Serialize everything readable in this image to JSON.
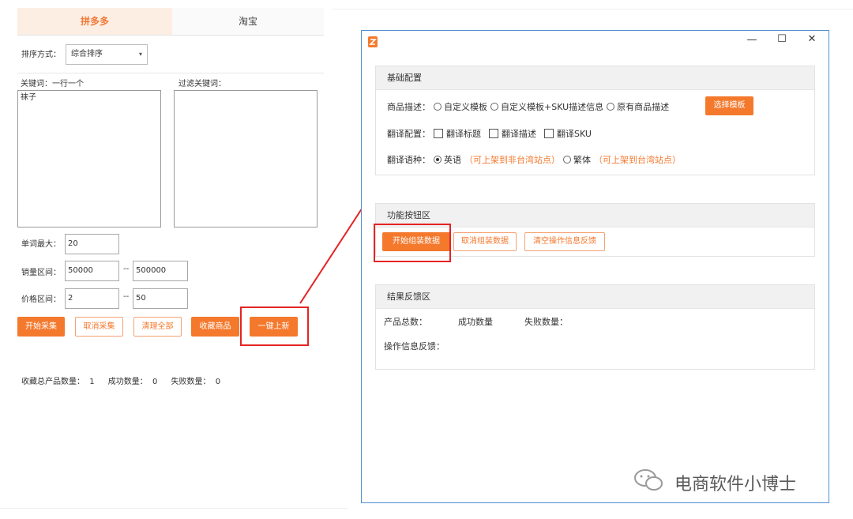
{
  "left": {
    "tabs": [
      {
        "label": "拼多多",
        "active": true
      },
      {
        "label": "淘宝",
        "active": false
      }
    ],
    "sort": {
      "label": "排序方式：",
      "value": "综合排序"
    },
    "keywords": {
      "label": "关键词：一行一个",
      "value": "袜子"
    },
    "filter": {
      "label": "过滤关键词：",
      "value": ""
    },
    "max_words": {
      "label": "单词最大：",
      "value": "20"
    },
    "sales_range": {
      "label": "销量区间：",
      "min": "50000",
      "sep": "--",
      "max": "500000"
    },
    "price_range": {
      "label": "价格区间：",
      "min": "2",
      "sep": "--",
      "max": "50"
    },
    "buttons": {
      "start": "开始采集",
      "cancel": "取消采集",
      "clear": "清理全部",
      "favorite": "收藏商品",
      "one_click": "一键上新"
    },
    "stats": {
      "total_label": "收藏总产品数量：",
      "total": "1",
      "success_label": "成功数量：",
      "success": "0",
      "fail_label": "失败数量：",
      "fail": "0"
    }
  },
  "window": {
    "controls": {
      "minimize": "—",
      "maximize": "☐",
      "close": "✕"
    },
    "basic": {
      "title": "基础配置",
      "desc_label": "商品描述：",
      "desc_options": [
        "自定义模板",
        "自定义模板+SKU描述信息",
        "原有商品描述"
      ],
      "template_button": "选择模板",
      "translate_label": "翻译配置：",
      "translate_options": [
        "翻译标题",
        "翻译描述",
        "翻译SKU"
      ],
      "lang_label": "翻译语种：",
      "lang_english": "英语",
      "lang_english_note": "（可上架到非台湾站点）",
      "lang_trad": "繁体",
      "lang_trad_note": "（可上架到台湾站点）"
    },
    "functions": {
      "title": "功能按钮区",
      "start": "开始组装数据",
      "cancel": "取消组装数据",
      "clear": "清空操作信息反馈"
    },
    "results": {
      "title": "结果反馈区",
      "total_label": "产品总数：",
      "success_label": "成功数量",
      "fail_label": "失败数量：",
      "feedback_label": "操作信息反馈："
    }
  },
  "watermark": "电商软件小博士",
  "colors": {
    "accent": "#f4792d",
    "highlight": "#e52424",
    "window_border": "#4f8fd1"
  }
}
